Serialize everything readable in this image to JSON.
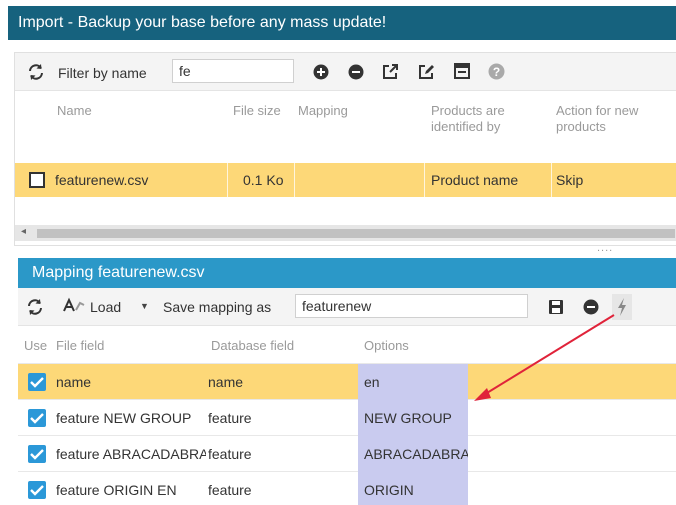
{
  "import_panel": {
    "title": "Import - Backup your base before any mass update!",
    "toolbar": {
      "filter_label": "Filter by name",
      "filter_value": "fe"
    },
    "columns": {
      "name": "Name",
      "file_size": "File size",
      "mapping": "Mapping",
      "identified_by_1": "Products are",
      "identified_by_2": "identified by",
      "action_1": "Action for new",
      "action_2": "products"
    },
    "rows": [
      {
        "name": "featurenew.csv",
        "file_size": "0.1 Ko",
        "mapping": "",
        "identified_by": "Product name",
        "action": "Skip"
      }
    ],
    "resize_handle": "...."
  },
  "mapping_panel": {
    "title": "Mapping featurenew.csv",
    "toolbar": {
      "load_label": "Load",
      "save_as_label": "Save mapping as",
      "mapping_name_value": "featurenew"
    },
    "columns": {
      "use": "Use",
      "file_field": "File field",
      "database_field": "Database field",
      "options": "Options"
    },
    "rows": [
      {
        "file_field": "name",
        "database_field": "name",
        "options": "en"
      },
      {
        "file_field": "feature NEW GROUP",
        "database_field": "feature",
        "options": "NEW GROUP"
      },
      {
        "file_field": "feature ABRACADABRA",
        "database_field": "feature",
        "options": "ABRACADABRA"
      },
      {
        "file_field": "feature ORIGIN EN",
        "database_field": "feature",
        "options": "ORIGIN"
      }
    ]
  },
  "icons": {
    "refresh": "refresh-icon",
    "add": "plus-circle-icon",
    "remove": "minus-circle-icon",
    "open": "external-link-icon",
    "edit": "edit-icon",
    "window": "window-icon",
    "help": "help-icon",
    "load": "load-icon",
    "save": "floppy-disk-icon",
    "run": "lightning-icon"
  },
  "colors": {
    "import_header": "#16627e",
    "mapping_header": "#2b98c8",
    "selected_row": "#fdd878",
    "options_cell": "#c9cbef",
    "checkbox": "#2b98d8",
    "annotation_arrow": "#e0233a"
  }
}
